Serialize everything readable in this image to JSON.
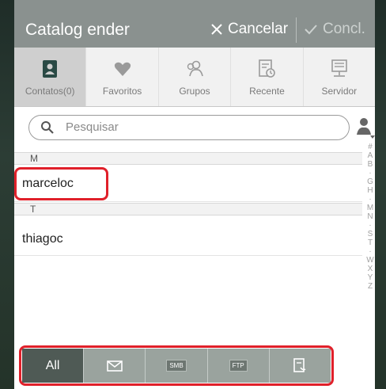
{
  "header": {
    "title": "Catalog ender",
    "cancel_label": "Cancelar",
    "confirm_label": "Concl."
  },
  "tabs": [
    {
      "label": "Contatos(0)",
      "icon": "contacts-icon",
      "active": true
    },
    {
      "label": "Favoritos",
      "icon": "heart-icon"
    },
    {
      "label": "Grupos",
      "icon": "group-icon"
    },
    {
      "label": "Recente",
      "icon": "recent-icon"
    },
    {
      "label": "Servidor",
      "icon": "server-icon"
    }
  ],
  "search": {
    "placeholder": "Pesquisar"
  },
  "list": {
    "sections": [
      {
        "header": "M",
        "items": [
          "marceloc"
        ]
      },
      {
        "header": "T",
        "items": [
          "thiagoc"
        ]
      }
    ]
  },
  "index": [
    "#",
    "A",
    "B",
    "·",
    "G",
    "H",
    "·",
    "M",
    "N",
    "·",
    "S",
    "T",
    "·",
    "W",
    "X",
    "Y",
    "Z"
  ],
  "bottom_bar": [
    {
      "label": "All",
      "active": true
    },
    {
      "icon": "mail-icon"
    },
    {
      "label": "SMB",
      "icon": "smb-icon"
    },
    {
      "label": "FTP",
      "icon": "ftp-icon"
    },
    {
      "icon": "note-phone-icon"
    }
  ],
  "colors": {
    "titlebar": "#8a918f",
    "highlight": "#e0202a",
    "bottom_active": "#4f5a55"
  }
}
